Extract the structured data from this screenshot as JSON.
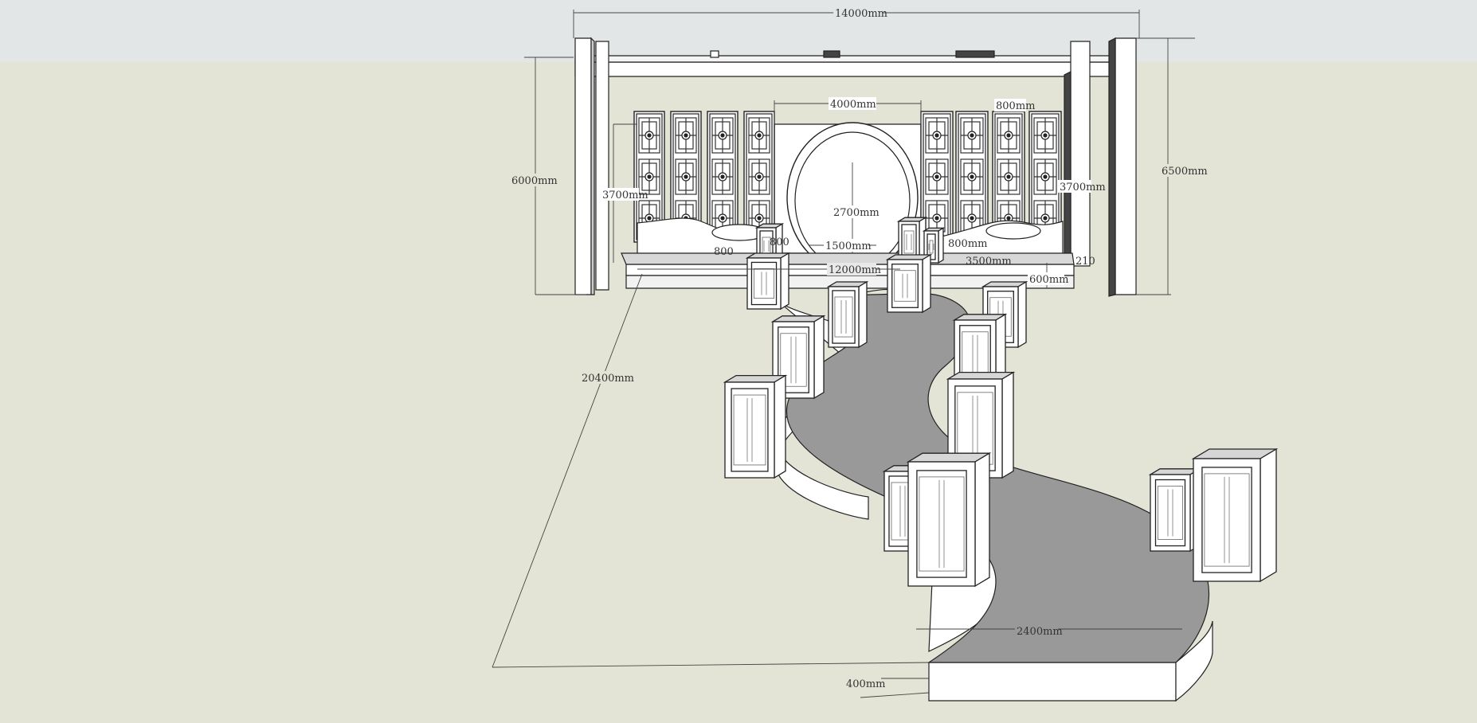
{
  "viewport": {
    "sky_color": "#e3e6e6",
    "ground_color": "#e4e4d6",
    "line_color": "#222222",
    "road_color": "#9a9a9a"
  },
  "dimensions": {
    "overall_width": "14000mm",
    "arch_width": "4000mm",
    "panel_width": "800mm",
    "left_height": "6000mm",
    "right_height": "6500mm",
    "screen_height": "3700mm",
    "screen_height_right": "3700mm",
    "arch_height": "2700mm",
    "door_width": "1500mm",
    "left_step": "800",
    "left_step_b": "800",
    "right_step": "800mm",
    "right_stage": "3500mm",
    "stage_width": "12000mm",
    "stage_height": "600mm",
    "edge_210": "210",
    "runway_length": "20400mm",
    "runway_width": "2400mm",
    "runway_height": "400mm"
  }
}
